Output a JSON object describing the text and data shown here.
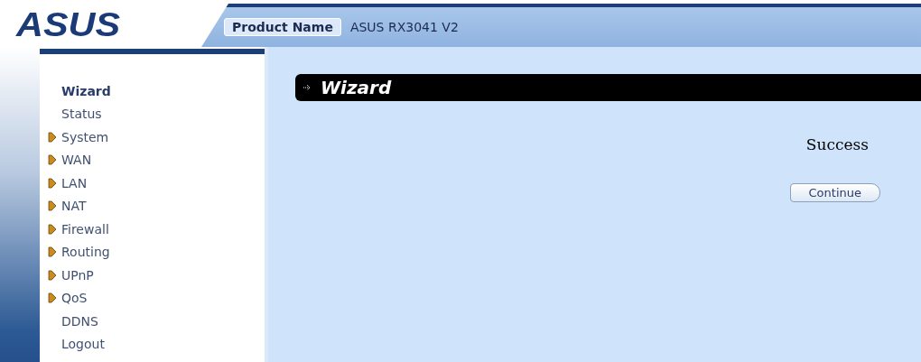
{
  "header": {
    "logo": "ASUS",
    "product_label": "Product Name",
    "product_value": "ASUS RX3041 V2"
  },
  "sidebar": {
    "items": [
      {
        "label": "Wizard",
        "selected": true,
        "has_submenu": false
      },
      {
        "label": "Status",
        "selected": false,
        "has_submenu": false
      },
      {
        "label": "System",
        "selected": false,
        "has_submenu": true
      },
      {
        "label": "WAN",
        "selected": false,
        "has_submenu": true
      },
      {
        "label": "LAN",
        "selected": false,
        "has_submenu": true
      },
      {
        "label": "NAT",
        "selected": false,
        "has_submenu": true
      },
      {
        "label": "Firewall",
        "selected": false,
        "has_submenu": true
      },
      {
        "label": "Routing",
        "selected": false,
        "has_submenu": true
      },
      {
        "label": "UPnP",
        "selected": false,
        "has_submenu": true
      },
      {
        "label": "QoS",
        "selected": false,
        "has_submenu": true
      },
      {
        "label": "DDNS",
        "selected": false,
        "has_submenu": false
      },
      {
        "label": "Logout",
        "selected": false,
        "has_submenu": false
      }
    ]
  },
  "content": {
    "title": "Wizard",
    "message": "Success",
    "button": "Continue"
  }
}
